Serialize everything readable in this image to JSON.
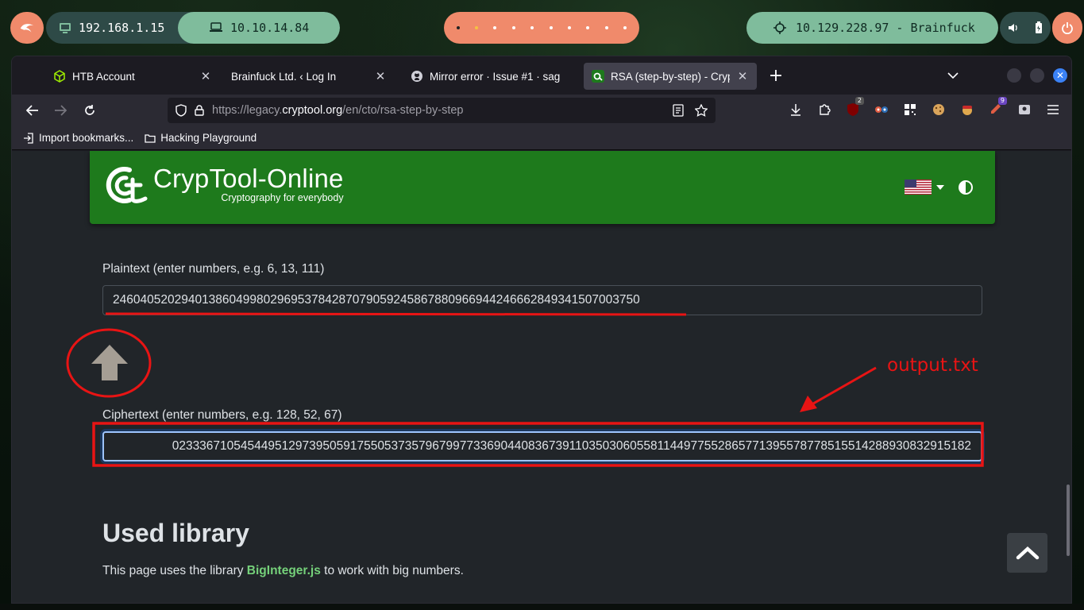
{
  "panel": {
    "local_ip": "192.168.1.15",
    "vpn_ip": "10.10.14.84",
    "target": "10.129.228.97 - Brainfuck"
  },
  "browser": {
    "tabs": [
      {
        "title": "HTB Account",
        "icon": "htb-cube-icon"
      },
      {
        "title": "Brainfuck Ltd. ‹ Log In",
        "icon": "none"
      },
      {
        "title": "Mirror error · Issue #1 · sag",
        "icon": "github-icon"
      },
      {
        "title": "RSA (step-by-step) - CrypTo",
        "icon": "cryptool-icon",
        "active": true
      }
    ],
    "url_prefix": "https://legacy.",
    "url_domain": "cryptool.org",
    "url_path": "/en/cto/rsa-step-by-step",
    "bookmarks": [
      {
        "label": "Import bookmarks...",
        "icon": "import-icon"
      },
      {
        "label": "Hacking Playground",
        "icon": "folder-icon"
      }
    ],
    "extension_badges": {
      "ublock": "2",
      "notes": "9"
    }
  },
  "site": {
    "brand_name": "CrypTool-Online",
    "brand_tagline": "Cryptography for everybody",
    "brand_color": "#1e7a1c"
  },
  "form": {
    "plaintext_label": "Plaintext (enter numbers, e.g. 6, 13, 111)",
    "plaintext_value": "24604052029401386049980296953784287079059245867880966944246662849341507003750",
    "ciphertext_label": "Ciphertext (enter numbers, e.g. 128, 52, 67)",
    "ciphertext_value": "023336710545449512973950591755053735796799773369044083673911035030605581144977552865771395578778515514288930832915182"
  },
  "content": {
    "section_title": "Used library",
    "para_before": "This page uses the library ",
    "para_link": "BigInteger.js",
    "para_after": " to work with big numbers."
  },
  "annotation": {
    "label": "output.txt",
    "color": "#e81414"
  }
}
